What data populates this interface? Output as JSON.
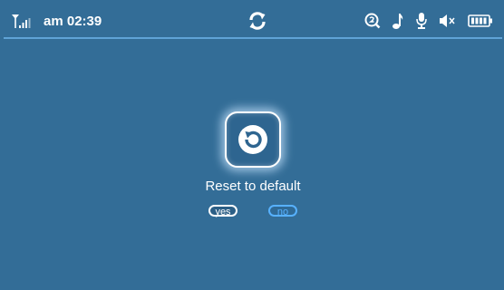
{
  "status": {
    "time": "am 02:39",
    "icons": [
      "signal-icon",
      "sync-icon",
      "search-icon",
      "music-note-icon",
      "microphone-icon",
      "speaker-mute-icon",
      "battery-icon"
    ]
  },
  "dialog": {
    "title": "Reset to default",
    "yes_label": "yes",
    "no_label": "no"
  },
  "colors": {
    "background": "#336d97",
    "accent": "#57b1ff",
    "divider": "#5fa3d6"
  }
}
